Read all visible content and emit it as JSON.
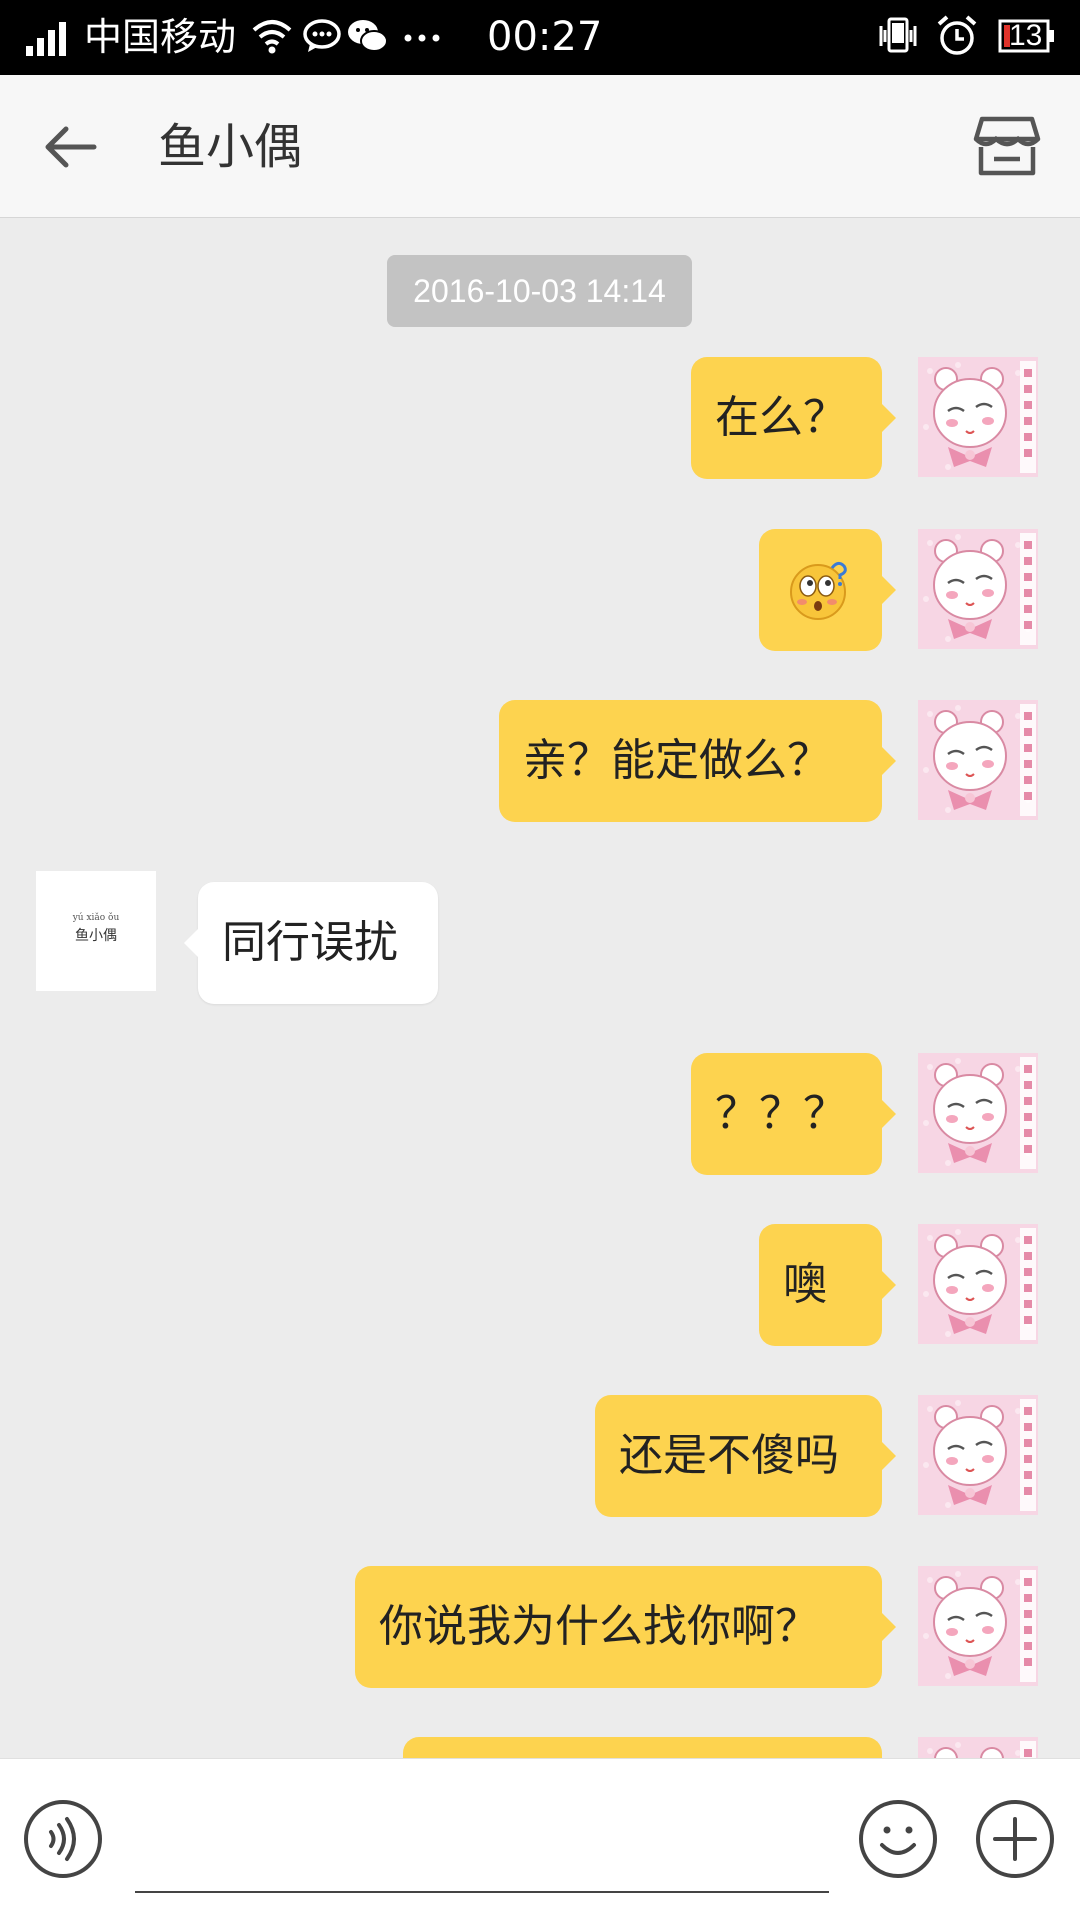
{
  "status_bar": {
    "carrier": "中国移动",
    "time": "00:27",
    "battery": "13",
    "icons": [
      "signal-icon",
      "wifi-icon",
      "message-icon",
      "wechat-icon",
      "more-dots-icon",
      "vibrate-icon",
      "alarm-icon",
      "battery-icon"
    ]
  },
  "header": {
    "title": "鱼小偶",
    "back_icon": "back-arrow-icon",
    "shop_icon": "store-icon"
  },
  "chat": {
    "timestamp": "2016-10-03 14:14",
    "shop_avatar": {
      "pinyin": "yú xiǎo ǒu",
      "name": "鱼小偶"
    },
    "messages": [
      {
        "from": "me",
        "text": "在么？"
      },
      {
        "from": "me",
        "emoji": "confused-face-emoji"
      },
      {
        "from": "me",
        "text": "亲？能定做么？"
      },
      {
        "from": "shop",
        "text": "同行误扰"
      },
      {
        "from": "me",
        "text": "？？？"
      },
      {
        "from": "me",
        "text": "噢"
      },
      {
        "from": "me",
        "text": "还是不傻吗"
      },
      {
        "from": "me",
        "text": "你说我为什么找你啊？"
      }
    ]
  },
  "input_bar": {
    "voice_icon": "voice-icon",
    "emoji_icon": "smiley-icon",
    "plus_icon": "plus-icon",
    "input_value": ""
  },
  "colors": {
    "my_bubble": "#fdd34f",
    "other_bubble": "#ffffff",
    "background": "#ececec",
    "timestamp_bg": "#c3c3c3"
  }
}
